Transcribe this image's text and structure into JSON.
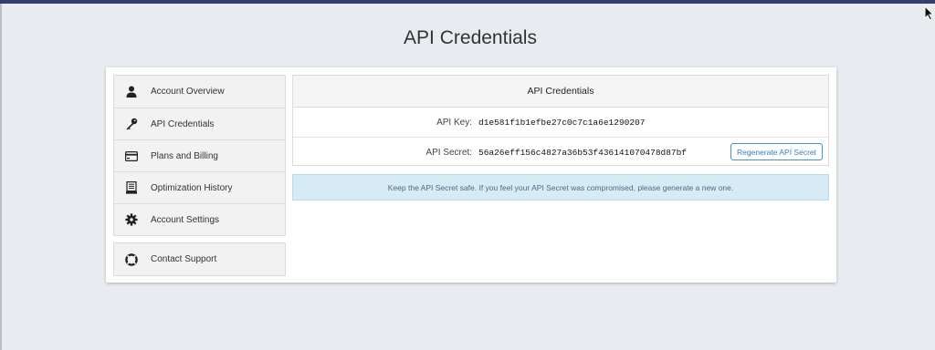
{
  "page": {
    "title": "API Credentials"
  },
  "sidebar": {
    "items": [
      {
        "label": "Account Overview",
        "icon": "user-icon"
      },
      {
        "label": "API Credentials",
        "icon": "key-icon"
      },
      {
        "label": "Plans and Billing",
        "icon": "credit-card-icon"
      },
      {
        "label": "Optimization History",
        "icon": "history-icon"
      },
      {
        "label": "Account Settings",
        "icon": "gear-icon"
      }
    ],
    "support": {
      "label": "Contact Support",
      "icon": "lifebuoy-icon"
    }
  },
  "panel": {
    "heading": "API Credentials",
    "api_key_label": "API Key:",
    "api_key_value": "d1e581f1b1efbe27c0c7c1a6e1290207",
    "api_secret_label": "API Secret:",
    "api_secret_value": "56a26eff156c4827a36b53f436141070478d87bf",
    "regenerate_label": "Regenerate API Secret"
  },
  "notice": {
    "text": "Keep the API Secret safe. If you feel your API Secret was compromised, please generate a new one."
  },
  "colors": {
    "topbar": "#34406b",
    "accent": "#3a7fb8",
    "notice_bg": "#d7ebf4"
  }
}
